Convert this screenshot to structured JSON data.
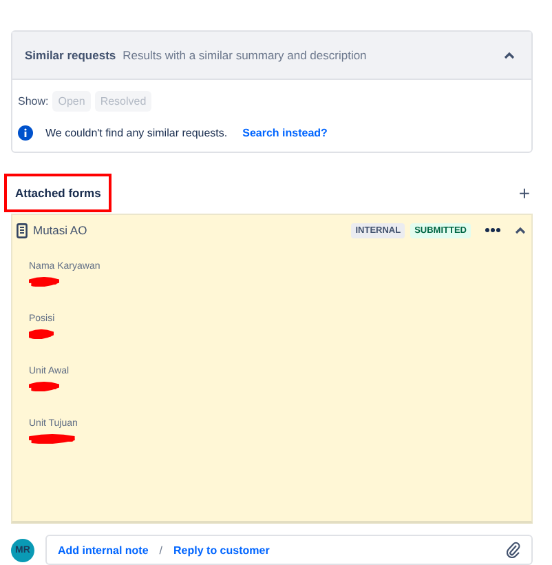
{
  "similar_requests": {
    "title": "Similar requests",
    "subtitle": "Results with a similar summary and description",
    "expanded": true,
    "show_label": "Show:",
    "filters": [
      {
        "label": "Open",
        "selected": false
      },
      {
        "label": "Resolved",
        "selected": false
      }
    ],
    "message": "We couldn't find any similar requests.",
    "link": "Search instead?"
  },
  "attached_forms": {
    "title": "Attached forms",
    "highlighted": true,
    "add": "+",
    "form": {
      "name": "Mutasi AO",
      "badges": [
        {
          "label": "INTERNAL",
          "kind": "neutral"
        },
        {
          "label": "SUBMITTED",
          "kind": "success"
        }
      ],
      "expanded": true,
      "fields": [
        {
          "label": "Nama Karyawan",
          "redacted": true
        },
        {
          "label": "Posisi",
          "redacted": true
        },
        {
          "label": "Unit Awal",
          "redacted": true
        },
        {
          "label": "Unit Tujuan",
          "redacted": true
        }
      ]
    }
  },
  "composer": {
    "avatar": "MR",
    "actions": [
      "Add internal note",
      "Reply to customer"
    ],
    "separator": "/"
  }
}
